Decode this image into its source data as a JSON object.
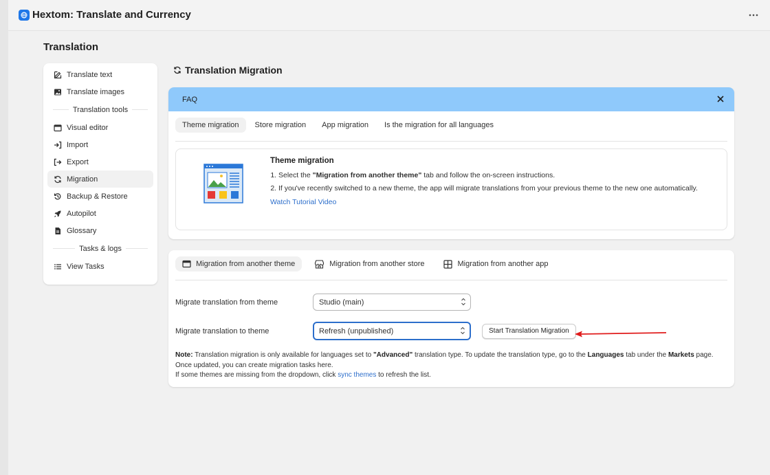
{
  "app": {
    "title": "Hextom: Translate and Currency",
    "more_label": "⋯"
  },
  "page": {
    "title": "Translation"
  },
  "sidebar": {
    "items_top": [
      {
        "label": "Translate text",
        "icon": "edit-icon"
      },
      {
        "label": "Translate images",
        "icon": "image-icon"
      }
    ],
    "section_tools": "Translation tools",
    "items_tools": [
      {
        "label": "Visual editor",
        "icon": "window-icon"
      },
      {
        "label": "Import",
        "icon": "import-icon"
      },
      {
        "label": "Export",
        "icon": "export-icon"
      },
      {
        "label": "Migration",
        "icon": "refresh-icon",
        "active": true
      },
      {
        "label": "Backup & Restore",
        "icon": "history-icon"
      },
      {
        "label": "Autopilot",
        "icon": "rocket-icon"
      },
      {
        "label": "Glossary",
        "icon": "document-icon"
      }
    ],
    "section_tasks": "Tasks & logs",
    "items_tasks": [
      {
        "label": "View Tasks",
        "icon": "list-icon"
      }
    ]
  },
  "section": {
    "title": "Translation Migration"
  },
  "faq": {
    "header": "FAQ",
    "tabs": [
      "Theme migration",
      "Store migration",
      "App migration",
      "Is the migration for all languages"
    ],
    "content_title": "Theme migration",
    "step1_pre": "Select the ",
    "step1_bold": "\"Migration from another theme\"",
    "step1_post": " tab and follow the on-screen instructions.",
    "step2": "If you've recently switched to a new theme, the app will migrate translations from your previous theme to the new one automatically.",
    "link": "Watch Tutorial Video"
  },
  "migration": {
    "tabs": [
      "Migration from another theme",
      "Migration from another store",
      "Migration from another app"
    ],
    "from_label": "Migrate translation from theme",
    "from_value": "Studio (main)",
    "to_label": "Migrate translation to theme",
    "to_value": "Refresh (unpublished)",
    "start_button": "Start Translation Migration",
    "note_label": "Note:",
    "note_1": " Translation migration is only available for languages set to ",
    "note_advanced": "\"Advanced\"",
    "note_2": " translation type. To update the translation type, go to the ",
    "note_languages": "Languages",
    "note_3": " tab under the ",
    "note_markets": "Markets",
    "note_4": " page.",
    "note_line2": "Once updated, you can create migration tasks here.",
    "note_line3_pre": "If some themes are missing from the dropdown, click ",
    "note_line3_link": "sync themes",
    "note_line3_post": " to refresh the list."
  },
  "colors": {
    "accent": "#2c6ecb",
    "faq_header": "#8fc9fb",
    "arrow": "#e01b1b"
  }
}
